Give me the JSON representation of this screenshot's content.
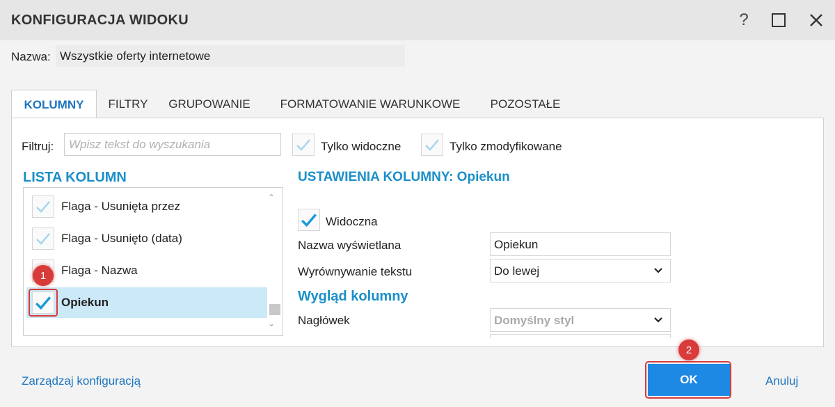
{
  "window": {
    "title": "KONFIGURACJA WIDOKU",
    "help_glyph": "?"
  },
  "name_field": {
    "label": "Nazwa:",
    "value": "Wszystkie oferty internetowe"
  },
  "tabs": [
    {
      "label": "KOLUMNY",
      "active": true
    },
    {
      "label": "FILTRY",
      "active": false
    },
    {
      "label": "GRUPOWANIE",
      "active": false
    },
    {
      "label": "FORMATOWANIE WARUNKOWE",
      "active": false
    },
    {
      "label": "POZOSTAŁE",
      "active": false
    }
  ],
  "filter": {
    "label": "Filtruj:",
    "placeholder": "Wpisz tekst do wyszukania",
    "only_visible_label": "Tylko widoczne",
    "only_modified_label": "Tylko zmodyfikowane"
  },
  "column_list": {
    "heading": "LISTA KOLUMN",
    "items": [
      {
        "label": "Flaga - Usunięta przez",
        "checked": false,
        "selected": false
      },
      {
        "label": "Flaga - Usunięto (data)",
        "checked": false,
        "selected": false
      },
      {
        "label": "Flaga - Nazwa",
        "checked": false,
        "selected": false
      },
      {
        "label": "Opiekun",
        "checked": true,
        "selected": true
      }
    ]
  },
  "column_settings": {
    "heading": "USTAWIENIA KOLUMNY: Opiekun",
    "visible_label": "Widoczna",
    "visible_checked": true,
    "display_name_label": "Nazwa wyświetlana",
    "display_name_value": "Opiekun",
    "alignment_label": "Wyrównywanie tekstu",
    "alignment_value": "Do lewej",
    "appearance_heading": "Wygląd kolumny",
    "header_label": "Nagłówek",
    "header_value": "Domyślny styl"
  },
  "annotations": {
    "badge_1": "1",
    "badge_2": "2"
  },
  "footer": {
    "manage_link": "Zarządzaj konfiguracją",
    "ok_label": "OK",
    "cancel_label": "Anuluj"
  },
  "colors": {
    "accent_blue": "#1d75c0",
    "section_blue": "#1a8fc8",
    "ok_button": "#1e88e5",
    "selection": "#cbe9f7",
    "annotation_red": "#d93a3a",
    "check_blue": "#1a9ad6",
    "check_light": "#a9d6ef"
  },
  "icons": {
    "help": "question-mark-icon",
    "maximize": "maximize-icon",
    "close": "close-icon",
    "checkmark": "checkmark-icon",
    "chevron": "chevron-down-icon"
  }
}
